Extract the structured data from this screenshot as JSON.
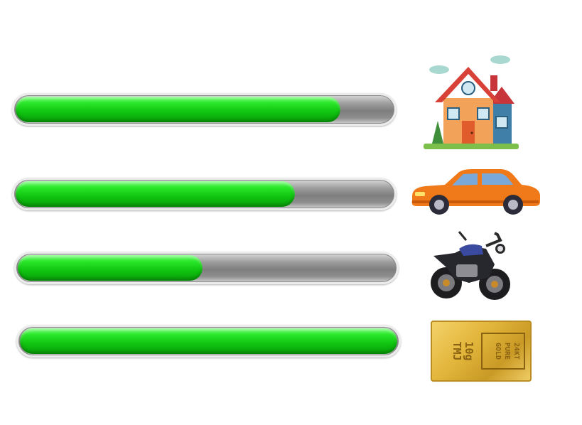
{
  "bars": [
    {
      "item": "house-icon",
      "progress": 0.86
    },
    {
      "item": "car-icon",
      "progress": 0.74
    },
    {
      "item": "motorcycle-icon",
      "progress": 0.49
    },
    {
      "item": "gold-bar-icon",
      "progress": 1.0
    }
  ],
  "gold_bar": {
    "text_right": "24KT PURE GOLD",
    "text_left": "10g TMJ"
  },
  "colors": {
    "fill": "#10c410",
    "track": "#8a8a8a",
    "house_roof": "#e0463a",
    "car_body": "#f07a1a",
    "gold": "#e2b53b"
  }
}
